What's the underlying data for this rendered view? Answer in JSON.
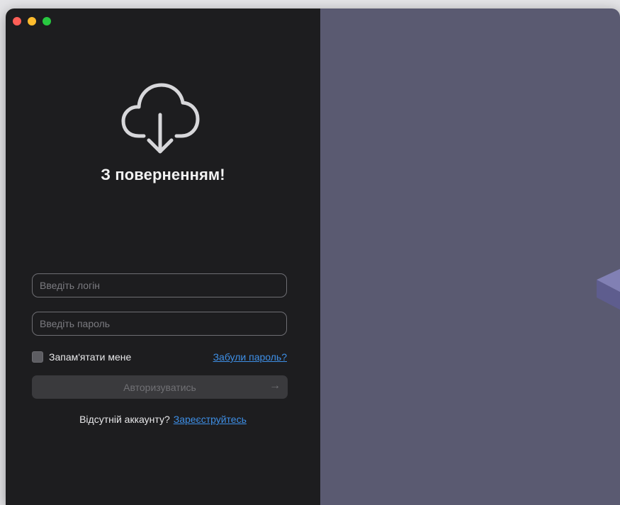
{
  "window": {
    "controls": [
      "close",
      "minimize",
      "zoom"
    ],
    "colors": {
      "close": "#ff5f57",
      "minimize": "#febc2e",
      "zoom": "#28c840"
    }
  },
  "login": {
    "icon": "cloud-download-icon",
    "title": "З поверненням!",
    "login_placeholder": "Введіть логін",
    "password_placeholder": "Введіть пароль",
    "remember_label": "Запам'ятати мене",
    "remember_checked": false,
    "forgot_label": "Забули пароль?",
    "submit_label": "Авторизуватись",
    "submit_icon": "arrow-right-icon",
    "no_account_text": "Відсутній аккаунту?",
    "register_label": "Зареєструйтесь"
  },
  "colors": {
    "left_panel": "#1d1d1f",
    "right_panel": "#5a5a71",
    "link": "#3e8fe6",
    "platform": "#8180b4"
  }
}
